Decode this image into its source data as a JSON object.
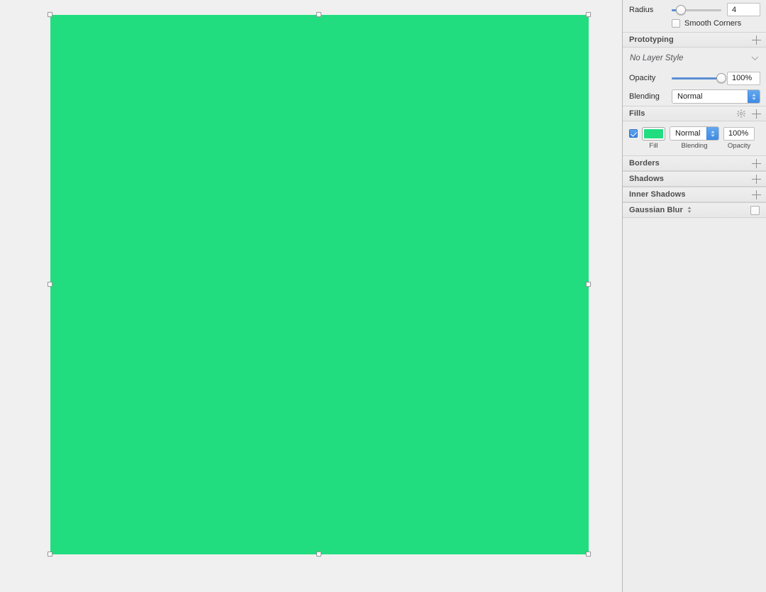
{
  "canvas": {
    "background_color": "#f0f0f0",
    "shape": {
      "name": "rounded-rectangle",
      "fill_color": "#22dd80",
      "corner_radius": 4,
      "selected": true
    }
  },
  "inspector": {
    "radius": {
      "label": "Radius",
      "value": "4",
      "slider_percent": 18,
      "smooth_corners_label": "Smooth Corners",
      "smooth_corners_checked": false
    },
    "prototyping": {
      "title": "Prototyping",
      "add_label": "+",
      "layer_style": "No Layer Style"
    },
    "appearance": {
      "opacity_label": "Opacity",
      "opacity_value": "100%",
      "opacity_percent": 100,
      "blending_label": "Blending",
      "blending_value": "Normal"
    },
    "fills": {
      "title": "Fills",
      "enabled": true,
      "color": "#22dd80",
      "blending_value": "Normal",
      "opacity_value": "100%",
      "caption_fill": "Fill",
      "caption_blending": "Blending",
      "caption_opacity": "Opacity"
    },
    "sections": [
      {
        "title": "Borders"
      },
      {
        "title": "Shadows"
      },
      {
        "title": "Inner Shadows"
      }
    ],
    "gaussian_blur": {
      "title": "Gaussian Blur",
      "enabled": false
    }
  },
  "colors": {
    "accent_blue": "#3f8ae2",
    "slider_blue": "#5b8fd4",
    "panel_bg": "#ededed",
    "header_text": "#4c4c4c"
  }
}
